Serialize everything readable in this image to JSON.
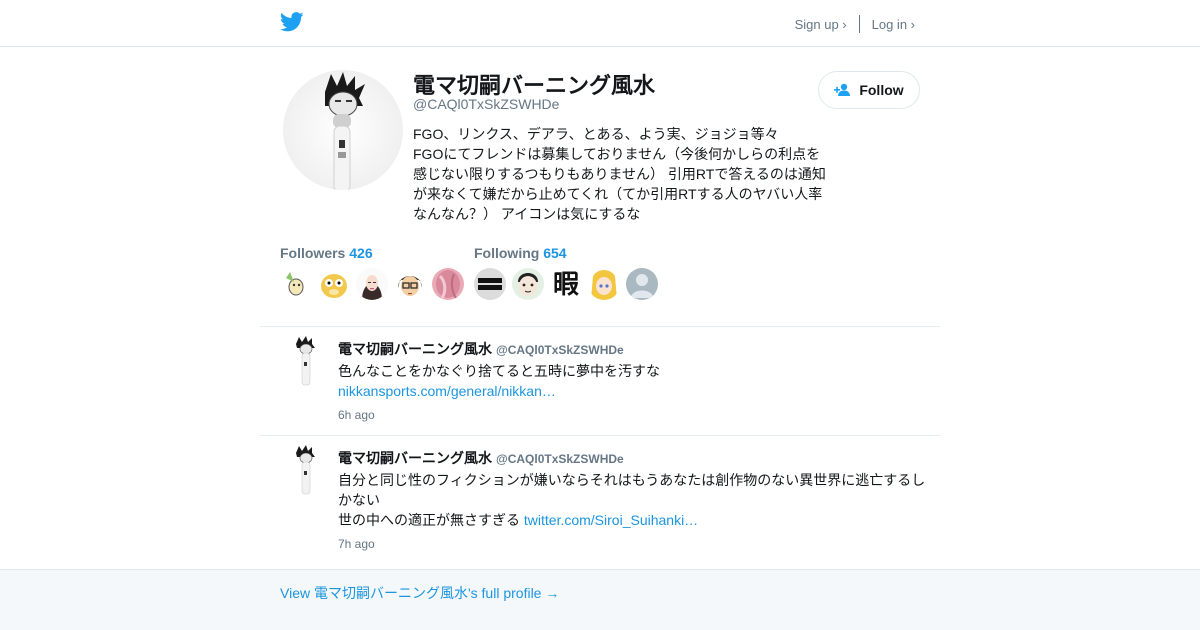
{
  "header": {
    "logo_icon": "twitter-bird-icon",
    "brand_color": "#1da1f2",
    "signup_label": "Sign up ›",
    "login_label": "Log in ›"
  },
  "profile": {
    "name": "電マ切嗣バーニング風水",
    "handle": "@CAQl0TxSkZSWHDe",
    "bio_lines": [
      "FGO、リンクス、デアラ、とある、よう実、ジョジョ等々",
      "FGOにてフレンドは募集しておりません（今後何かしらの利点を",
      "感じない限りするつもりもありません） 引用RTで答えるのは通知",
      "が来なくて嫌だから止めてくれ（てか引用RTする人のヤバい人率",
      "なんなん？） アイコンは気にするな"
    ],
    "follow_label": "Follow",
    "follow_icon": "add-user-icon"
  },
  "stats": {
    "followers_label": "Followers",
    "followers_count": "426",
    "following_label": "Following",
    "following_count": "654",
    "following_text_avatar": "暇"
  },
  "tweets": [
    {
      "name": "電マ切嗣バーニング風水",
      "handle": "@CAQl0TxSkZSWHDe",
      "text_line1": "色んなことをかなぐり捨てると五時に夢中を汚すな",
      "link": "nikkansports.com/general/nikkan…",
      "time": "6h ago"
    },
    {
      "name": "電マ切嗣バーニング風水",
      "handle": "@CAQl0TxSkZSWHDe",
      "text_line1": "自分と同じ性のフィクションが嫌いならそれはもうあなたは創作物のない異世界に逃亡するしかない",
      "text_line2": "世の中への適正が無さすぎる",
      "link": "twitter.com/Siroi_Suihanki…",
      "time": "7h ago"
    }
  ],
  "footer": {
    "link_label": "View 電マ切嗣バーニング風水's full profile →"
  }
}
